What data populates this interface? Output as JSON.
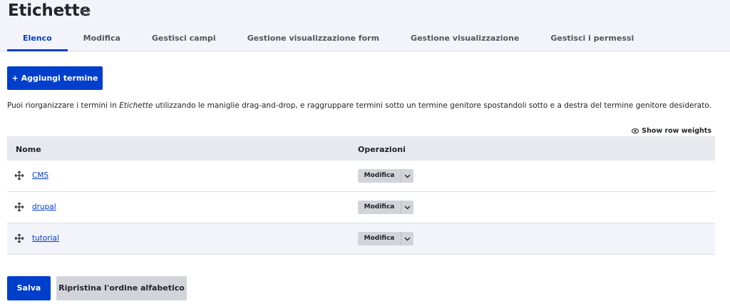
{
  "page": {
    "title": "Etichette",
    "favorite_icon": "star-outline-icon"
  },
  "tabs": [
    {
      "label": "Elenco",
      "active": true
    },
    {
      "label": "Modifica",
      "active": false
    },
    {
      "label": "Gestisci campi",
      "active": false
    },
    {
      "label": "Gestione visualizzazione form",
      "active": false
    },
    {
      "label": "Gestione visualizzazione",
      "active": false
    },
    {
      "label": "Gestisci i permessi",
      "active": false
    }
  ],
  "actions": {
    "add_term_label": "+ Aggiungi termine"
  },
  "help": {
    "prefix": "Puoi riorganizzare i termini in ",
    "vocabulary": "Etichette",
    "suffix": " utilizzando le maniglie drag-and-drop, e raggruppare termini sotto un termine genitore spostandoli sotto e a destra del termine genitore desiderato."
  },
  "table": {
    "show_weights_label": "Show row weights",
    "headers": {
      "name": "Nome",
      "operations": "Operazioni"
    },
    "rows": [
      {
        "name": "CMS",
        "operation": "Modifica"
      },
      {
        "name": "drupal",
        "operation": "Modifica"
      },
      {
        "name": "tutorial",
        "operation": "Modifica"
      }
    ]
  },
  "footer": {
    "save_label": "Salva",
    "reset_label": "Ripristina l'ordine alfabetico"
  },
  "colors": {
    "accent": "#003ecc",
    "header_bg": "#f3f4f9",
    "button_gray": "#d3d4d9"
  }
}
